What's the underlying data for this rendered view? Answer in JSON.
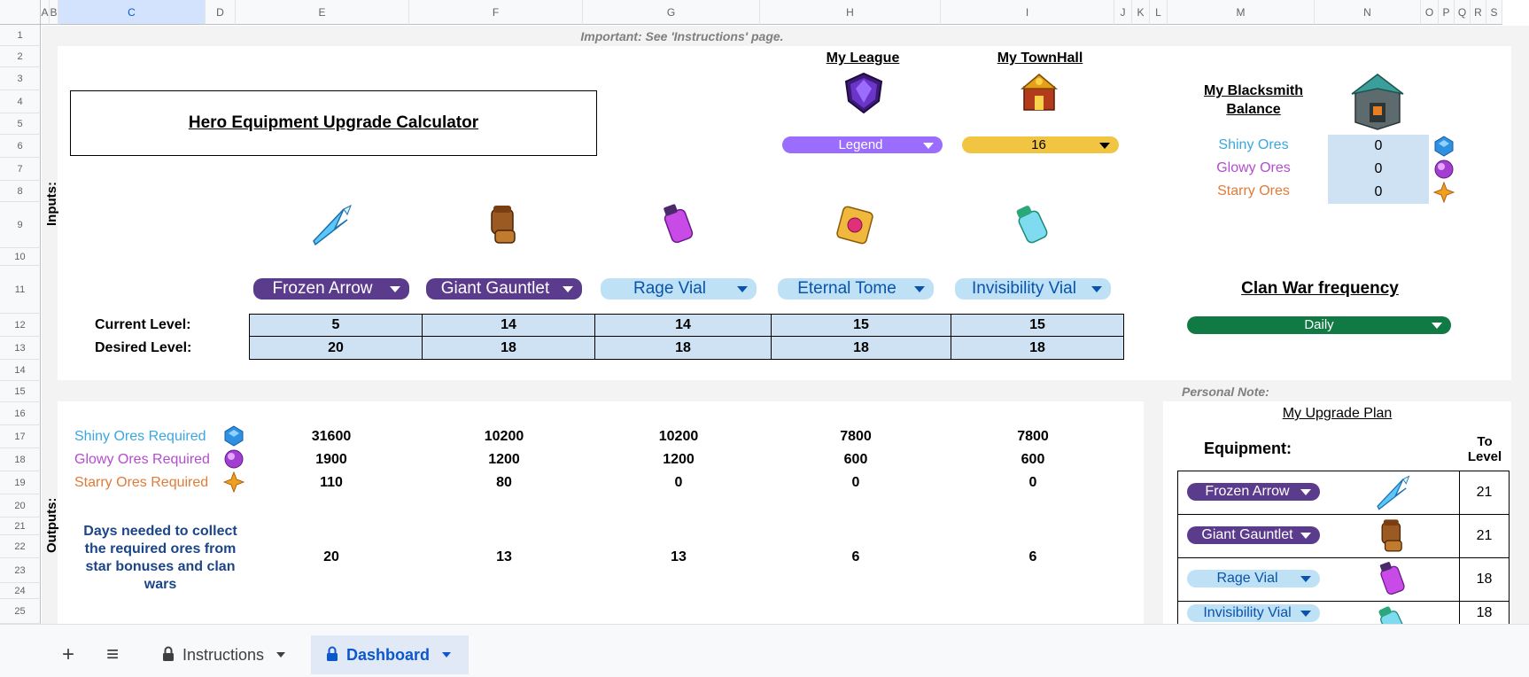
{
  "columns": [
    "A",
    "B",
    "C",
    "D",
    "E",
    "F",
    "G",
    "H",
    "I",
    "J",
    "K",
    "L",
    "M",
    "N",
    "O",
    "P",
    "Q",
    "R",
    "S"
  ],
  "rows": [
    "1",
    "2",
    "3",
    "4",
    "5",
    "6",
    "7",
    "8",
    "9",
    "10",
    "11",
    "12",
    "13",
    "14",
    "15",
    "16",
    "17",
    "18",
    "19",
    "20",
    "21",
    "22",
    "23",
    "24",
    "25"
  ],
  "notice": "Important: See 'Instructions' page.",
  "title": "Hero Equipment Upgrade Calculator",
  "inputs_label": "Inputs:",
  "outputs_label": "Outputs:",
  "league": {
    "heading": "My League",
    "value": "Legend",
    "color": "#9b6dff"
  },
  "townhall": {
    "heading": "My TownHall",
    "value": "16",
    "color": "#f1c542"
  },
  "blacksmith": {
    "heading_line1": "My Blacksmith",
    "heading_line2": "Balance",
    "ores": [
      {
        "name": "Shiny Ores",
        "value": "0",
        "color": "#3aa7e0",
        "icon": "shiny-ore-icon"
      },
      {
        "name": "Glowy Ores",
        "value": "0",
        "color": "#b44ccf",
        "icon": "glowy-ore-icon"
      },
      {
        "name": "Starry Ores",
        "value": "0",
        "color": "#e07b39",
        "icon": "starry-ore-icon"
      }
    ]
  },
  "clan_war": {
    "heading": "Clan War frequency",
    "value": "Daily",
    "color": "#117a44"
  },
  "equipment": [
    {
      "name": "Frozen Arrow",
      "style": "purple",
      "icon": "frozen-arrow-icon",
      "current": "5",
      "desired": "20",
      "shiny": "31600",
      "glowy": "1900",
      "starry": "110",
      "days": "20"
    },
    {
      "name": "Giant Gauntlet",
      "style": "purple",
      "icon": "giant-gauntlet-icon",
      "current": "14",
      "desired": "18",
      "shiny": "10200",
      "glowy": "1200",
      "starry": "80",
      "days": "13"
    },
    {
      "name": "Rage Vial",
      "style": "lightblue",
      "icon": "rage-vial-icon",
      "current": "14",
      "desired": "18",
      "shiny": "10200",
      "glowy": "1200",
      "starry": "0",
      "days": "13"
    },
    {
      "name": "Eternal Tome",
      "style": "lightblue",
      "icon": "eternal-tome-icon",
      "current": "15",
      "desired": "18",
      "shiny": "7800",
      "glowy": "600",
      "starry": "0",
      "days": "6"
    },
    {
      "name": "Invisibility Vial",
      "style": "lightblue",
      "icon": "invisibility-vial-icon",
      "current": "15",
      "desired": "18",
      "shiny": "7800",
      "glowy": "600",
      "starry": "0",
      "days": "6"
    }
  ],
  "labels": {
    "current_level": "Current Level:",
    "desired_level": "Desired Level:",
    "shiny_required": "Shiny Ores Required",
    "glowy_required": "Glowy Ores Required",
    "starry_required": "Starry Ores Required",
    "days_line1": "Days needed to collect",
    "days_line2": "the required ores from",
    "days_line3": "star bonuses and clan",
    "days_line4": "wars"
  },
  "personal_note": "Personal Note:",
  "plan": {
    "heading": "My Upgrade Plan",
    "equipment_label": "Equipment:",
    "to_level_line1": "To",
    "to_level_line2": "Level",
    "rows": [
      {
        "name": "Frozen Arrow",
        "style": "purple",
        "icon": "frozen-arrow-icon",
        "level": "21"
      },
      {
        "name": "Giant Gauntlet",
        "style": "purple",
        "icon": "giant-gauntlet-icon",
        "level": "21"
      },
      {
        "name": "Rage Vial",
        "style": "lightblue",
        "icon": "rage-vial-icon",
        "level": "18"
      },
      {
        "name": "Invisibility Vial",
        "style": "lightblue",
        "icon": "invisibility-vial-icon",
        "level": "18"
      }
    ]
  },
  "tabs": {
    "add_label": "+",
    "menu_label": "≡",
    "items": [
      {
        "name": "Instructions",
        "active": false
      },
      {
        "name": "Dashboard",
        "active": true
      }
    ]
  }
}
